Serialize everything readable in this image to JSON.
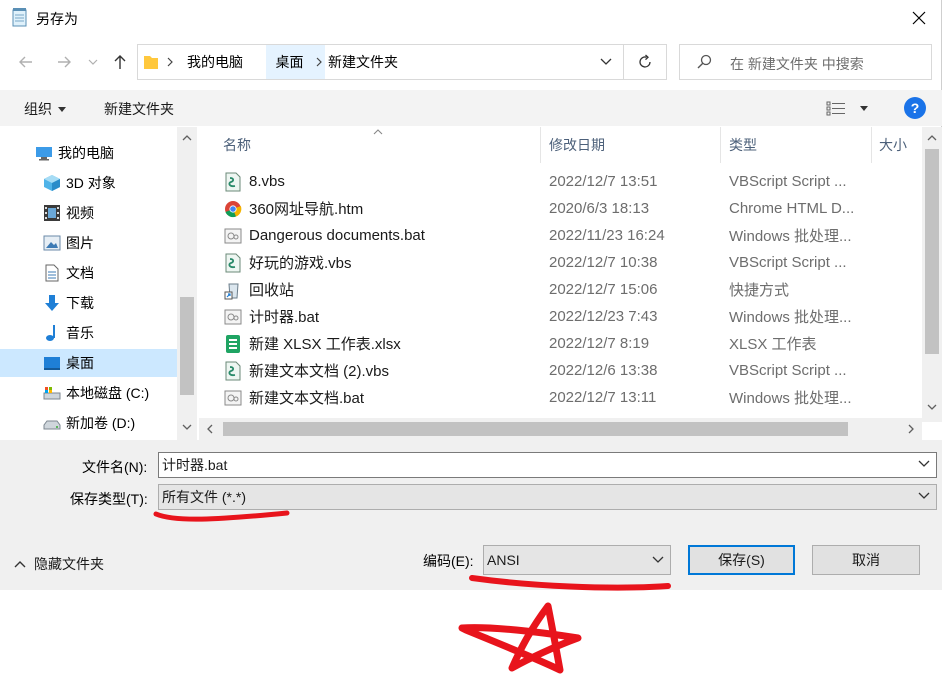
{
  "window": {
    "title": "另存为"
  },
  "nav": {
    "breadcrumbs": [
      "我的电脑",
      "桌面",
      "新建文件夹"
    ],
    "search_placeholder": "在 新建文件夹 中搜索"
  },
  "toolbar": {
    "organize_label": "组织",
    "new_folder_label": "新建文件夹"
  },
  "sidebar": {
    "items": [
      {
        "label": "我的电脑",
        "icon": "computer-icon"
      },
      {
        "label": "3D 对象",
        "icon": "cube-icon"
      },
      {
        "label": "视频",
        "icon": "video-icon"
      },
      {
        "label": "图片",
        "icon": "picture-icon"
      },
      {
        "label": "文档",
        "icon": "document-icon"
      },
      {
        "label": "下载",
        "icon": "download-icon"
      },
      {
        "label": "音乐",
        "icon": "music-icon"
      },
      {
        "label": "桌面",
        "icon": "desktop-icon",
        "selected": true
      },
      {
        "label": "本地磁盘 (C:)",
        "icon": "drive-c-icon"
      },
      {
        "label": "新加卷 (D:)",
        "icon": "drive-icon"
      }
    ]
  },
  "columns": {
    "name": "名称",
    "date": "修改日期",
    "type": "类型",
    "size": "大小"
  },
  "files": [
    {
      "name": "8.vbs",
      "date": "2022/12/7 13:51",
      "type": "VBScript Script ...",
      "icon": "vbs"
    },
    {
      "name": "360网址导航.htm",
      "date": "2020/6/3 18:13",
      "type": "Chrome HTML D...",
      "icon": "chrome"
    },
    {
      "name": "Dangerous documents.bat",
      "date": "2022/11/23 16:24",
      "type": "Windows 批处理...",
      "icon": "bat"
    },
    {
      "name": "好玩的游戏.vbs",
      "date": "2022/12/7 10:38",
      "type": "VBScript Script ...",
      "icon": "vbs"
    },
    {
      "name": "回收站",
      "date": "2022/12/7 15:06",
      "type": "快捷方式",
      "icon": "shortcut"
    },
    {
      "name": "计时器.bat",
      "date": "2022/12/23 7:43",
      "type": "Windows 批处理...",
      "icon": "bat"
    },
    {
      "name": "新建 XLSX 工作表.xlsx",
      "date": "2022/12/7 8:19",
      "type": "XLSX 工作表",
      "icon": "xlsx"
    },
    {
      "name": "新建文本文档 (2).vbs",
      "date": "2022/12/6 13:38",
      "type": "VBScript Script ...",
      "icon": "vbs"
    },
    {
      "name": "新建文本文档.bat",
      "date": "2022/12/7 13:11",
      "type": "Windows 批处理...",
      "icon": "bat"
    }
  ],
  "form": {
    "filename_label": "文件名(N):",
    "filename_value": "计时器.bat",
    "filetype_label": "保存类型(T):",
    "filetype_value": "所有文件  (*.*)",
    "encoding_label": "编码(E):",
    "encoding_value": "ANSI",
    "save_label": "保存(S)",
    "cancel_label": "取消",
    "hide_folders_label": "隐藏文件夹"
  },
  "colors": {
    "accent": "#0078d7",
    "selection": "#cce8ff",
    "annotation": "#e8141c"
  }
}
